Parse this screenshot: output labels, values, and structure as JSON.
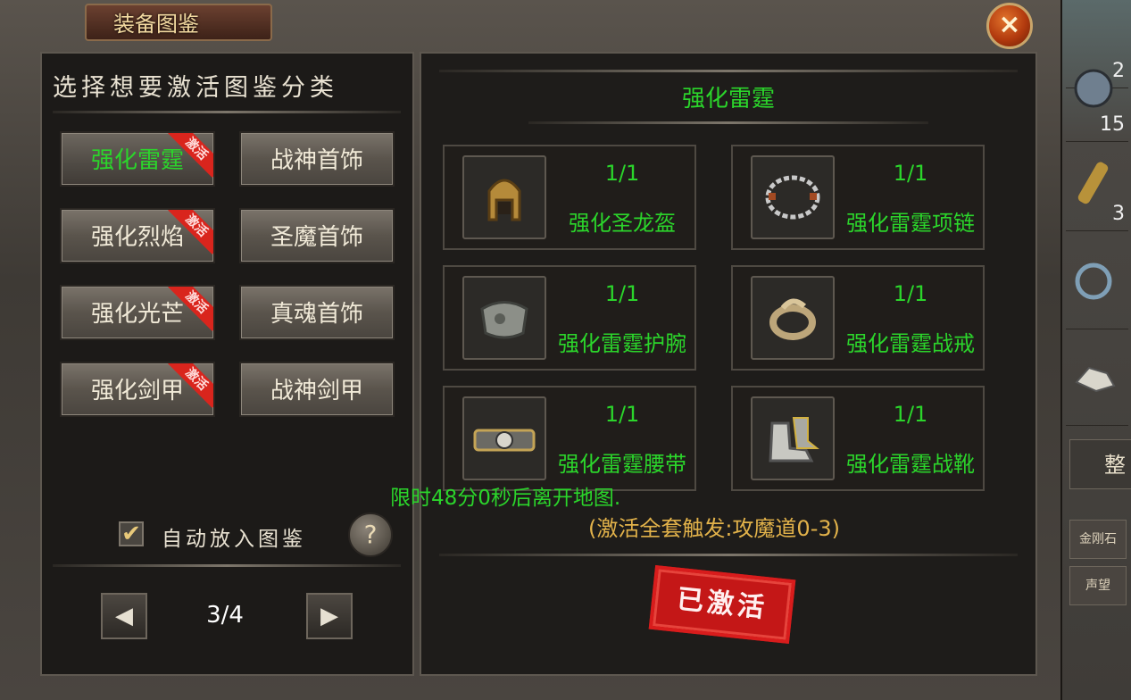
{
  "window": {
    "title": "装备图鉴",
    "close_icon": "×"
  },
  "left": {
    "title": "选择想要激活图鉴分类",
    "categories": [
      {
        "label": "强化雷霆",
        "badge": "激活",
        "selected": true
      },
      {
        "label": "战神首饰",
        "badge": ""
      },
      {
        "label": "强化烈焰",
        "badge": "激活"
      },
      {
        "label": "圣魔首饰",
        "badge": ""
      },
      {
        "label": "强化光芒",
        "badge": "激活"
      },
      {
        "label": "真魂首饰",
        "badge": ""
      },
      {
        "label": "强化剑甲",
        "badge": "激活"
      },
      {
        "label": "战神剑甲",
        "badge": ""
      }
    ],
    "auto_checkbox": {
      "checked": true,
      "label": "自动放入图鉴",
      "check_icon": "✔"
    },
    "help_icon": "?",
    "pager": {
      "prev_icon": "◀",
      "next_icon": "▶",
      "page": "3/4"
    }
  },
  "right": {
    "title": "强化雷霆",
    "items": [
      {
        "count": "1/1",
        "name": "强化圣龙盔",
        "icon": "helmet-icon"
      },
      {
        "count": "1/1",
        "name": "强化雷霆项链",
        "icon": "necklace-icon"
      },
      {
        "count": "1/1",
        "name": "强化雷霆护腕",
        "icon": "bracer-icon"
      },
      {
        "count": "1/1",
        "name": "强化雷霆战戒",
        "icon": "ring-icon"
      },
      {
        "count": "1/1",
        "name": "强化雷霆腰带",
        "icon": "belt-icon"
      },
      {
        "count": "1/1",
        "name": "强化雷霆战靴",
        "icon": "boots-icon"
      }
    ],
    "notice": "限时48分0秒后离开地图.",
    "set_bonus": "(激活全套触发:攻魔道0-3)",
    "stamp": "已激活"
  },
  "side": {
    "counts": [
      "2",
      "15",
      "3"
    ],
    "big_button": "整",
    "buttons": [
      "金刚石",
      "声望"
    ]
  },
  "colors": {
    "green": "#2bd52b",
    "gold": "#e2b24a",
    "red": "#d81c1c"
  }
}
